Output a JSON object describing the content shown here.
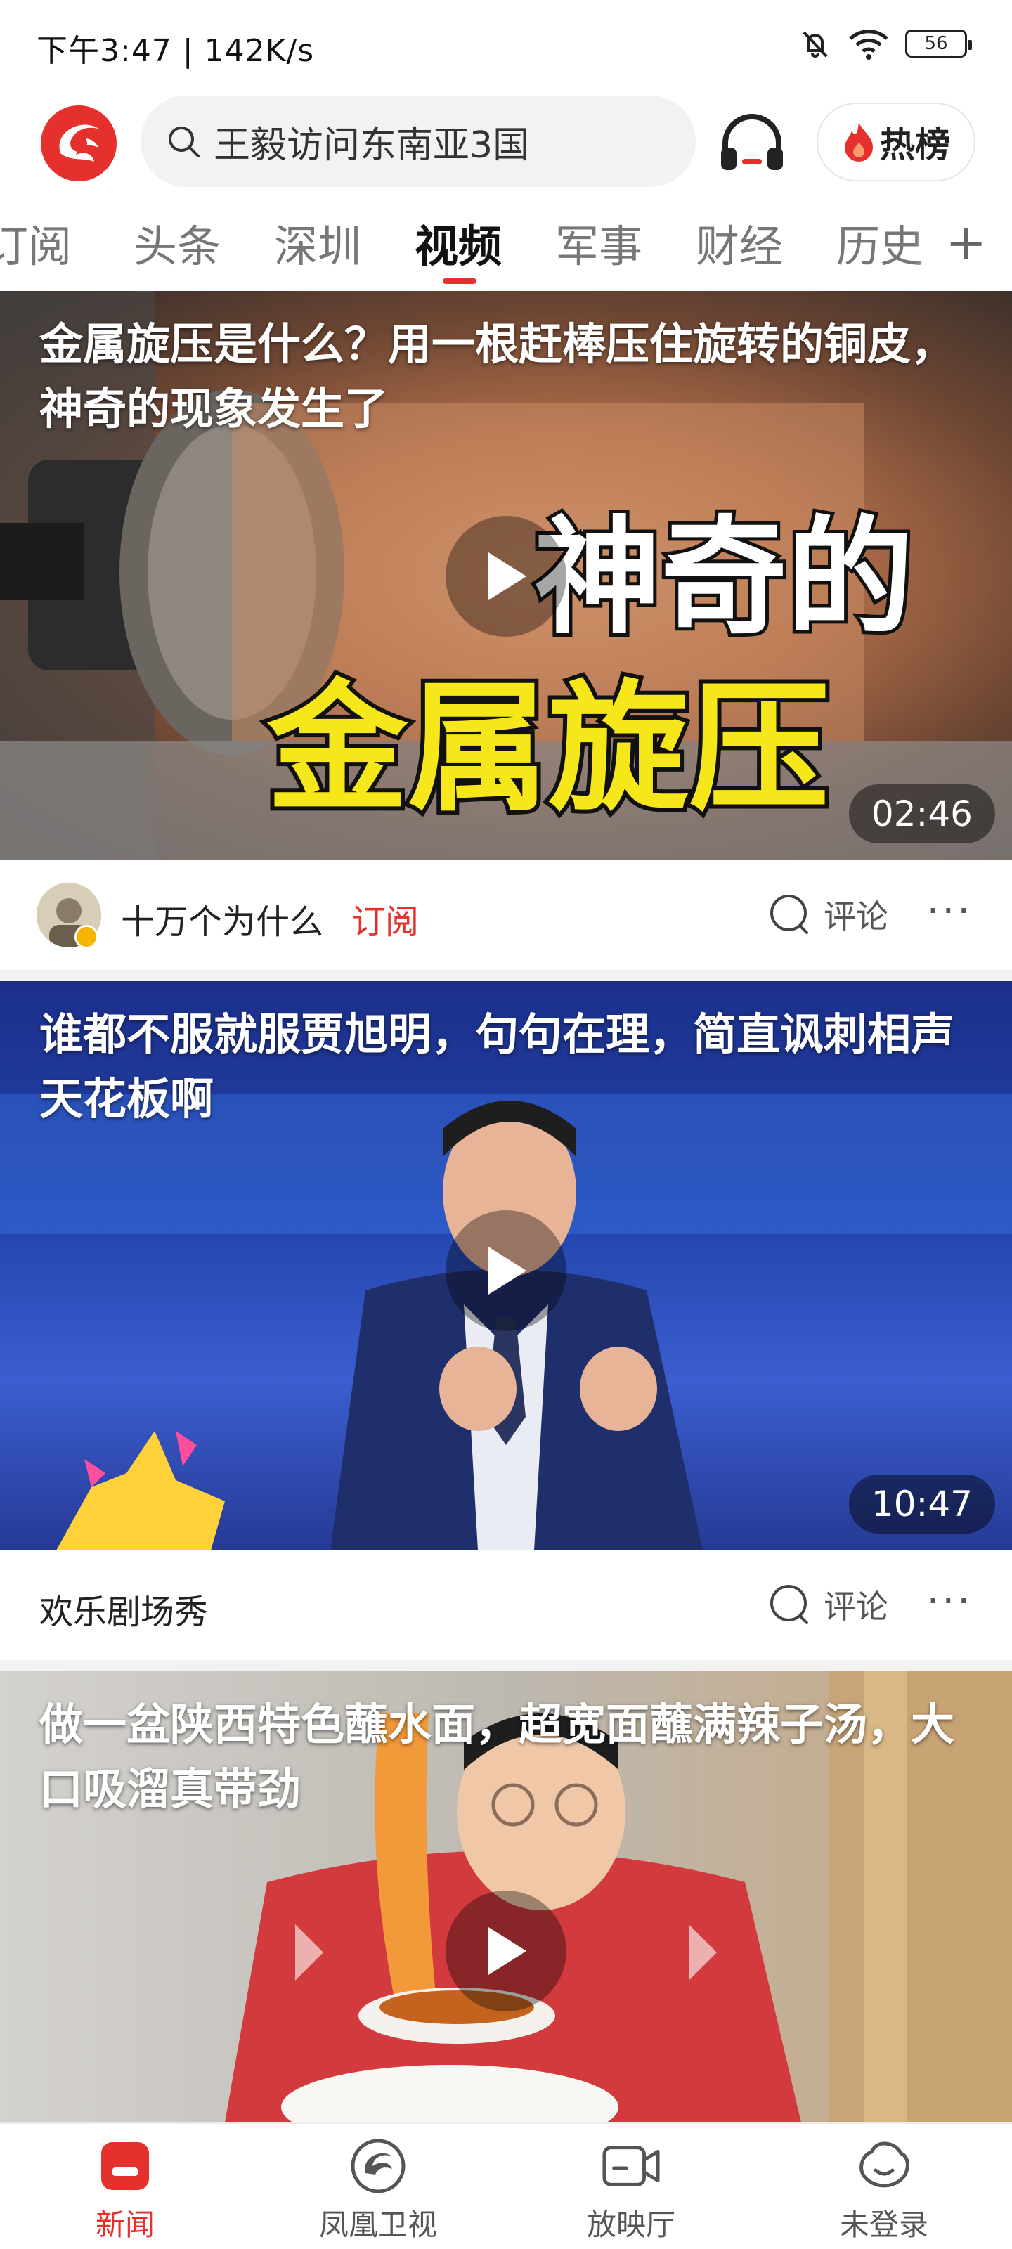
{
  "status_bar": {
    "time_speed": "下午3:47 | 142K/s",
    "battery": "56"
  },
  "header": {
    "search_placeholder": "王毅访问东南亚3国",
    "hot_label": "热榜"
  },
  "tabs": [
    {
      "label": "订阅"
    },
    {
      "label": "头条"
    },
    {
      "label": "深圳"
    },
    {
      "label": "视频",
      "active": true
    },
    {
      "label": "军事"
    },
    {
      "label": "财经"
    },
    {
      "label": "历史"
    }
  ],
  "feed": [
    {
      "title": "金属旋压是什么？用一根赶棒压住旋转的铜皮，神奇的现象发生了",
      "overlay_line1": "神奇的",
      "overlay_line2": "金属旋压",
      "duration": "02:46",
      "source": "十万个为什么",
      "subscribe": "订阅",
      "comment": "评论"
    },
    {
      "title": "谁都不服就服贾旭明，句句在理，简直讽刺相声天花板啊",
      "duration": "10:47",
      "source": "欢乐剧场秀",
      "comment": "评论"
    },
    {
      "title": "做一盆陕西特色蘸水面，超宽面蘸满辣子汤，大口吸溜真带劲"
    }
  ],
  "bottom_nav": [
    {
      "label": "新闻",
      "icon": "news-icon",
      "active": true
    },
    {
      "label": "凤凰卫视",
      "icon": "phoenix-tv-icon"
    },
    {
      "label": "放映厅",
      "icon": "video-camera-icon"
    },
    {
      "label": "未登录",
      "icon": "user-icon"
    }
  ],
  "colors": {
    "accent": "#e5302d",
    "text": "#222222",
    "muted": "#777777"
  }
}
